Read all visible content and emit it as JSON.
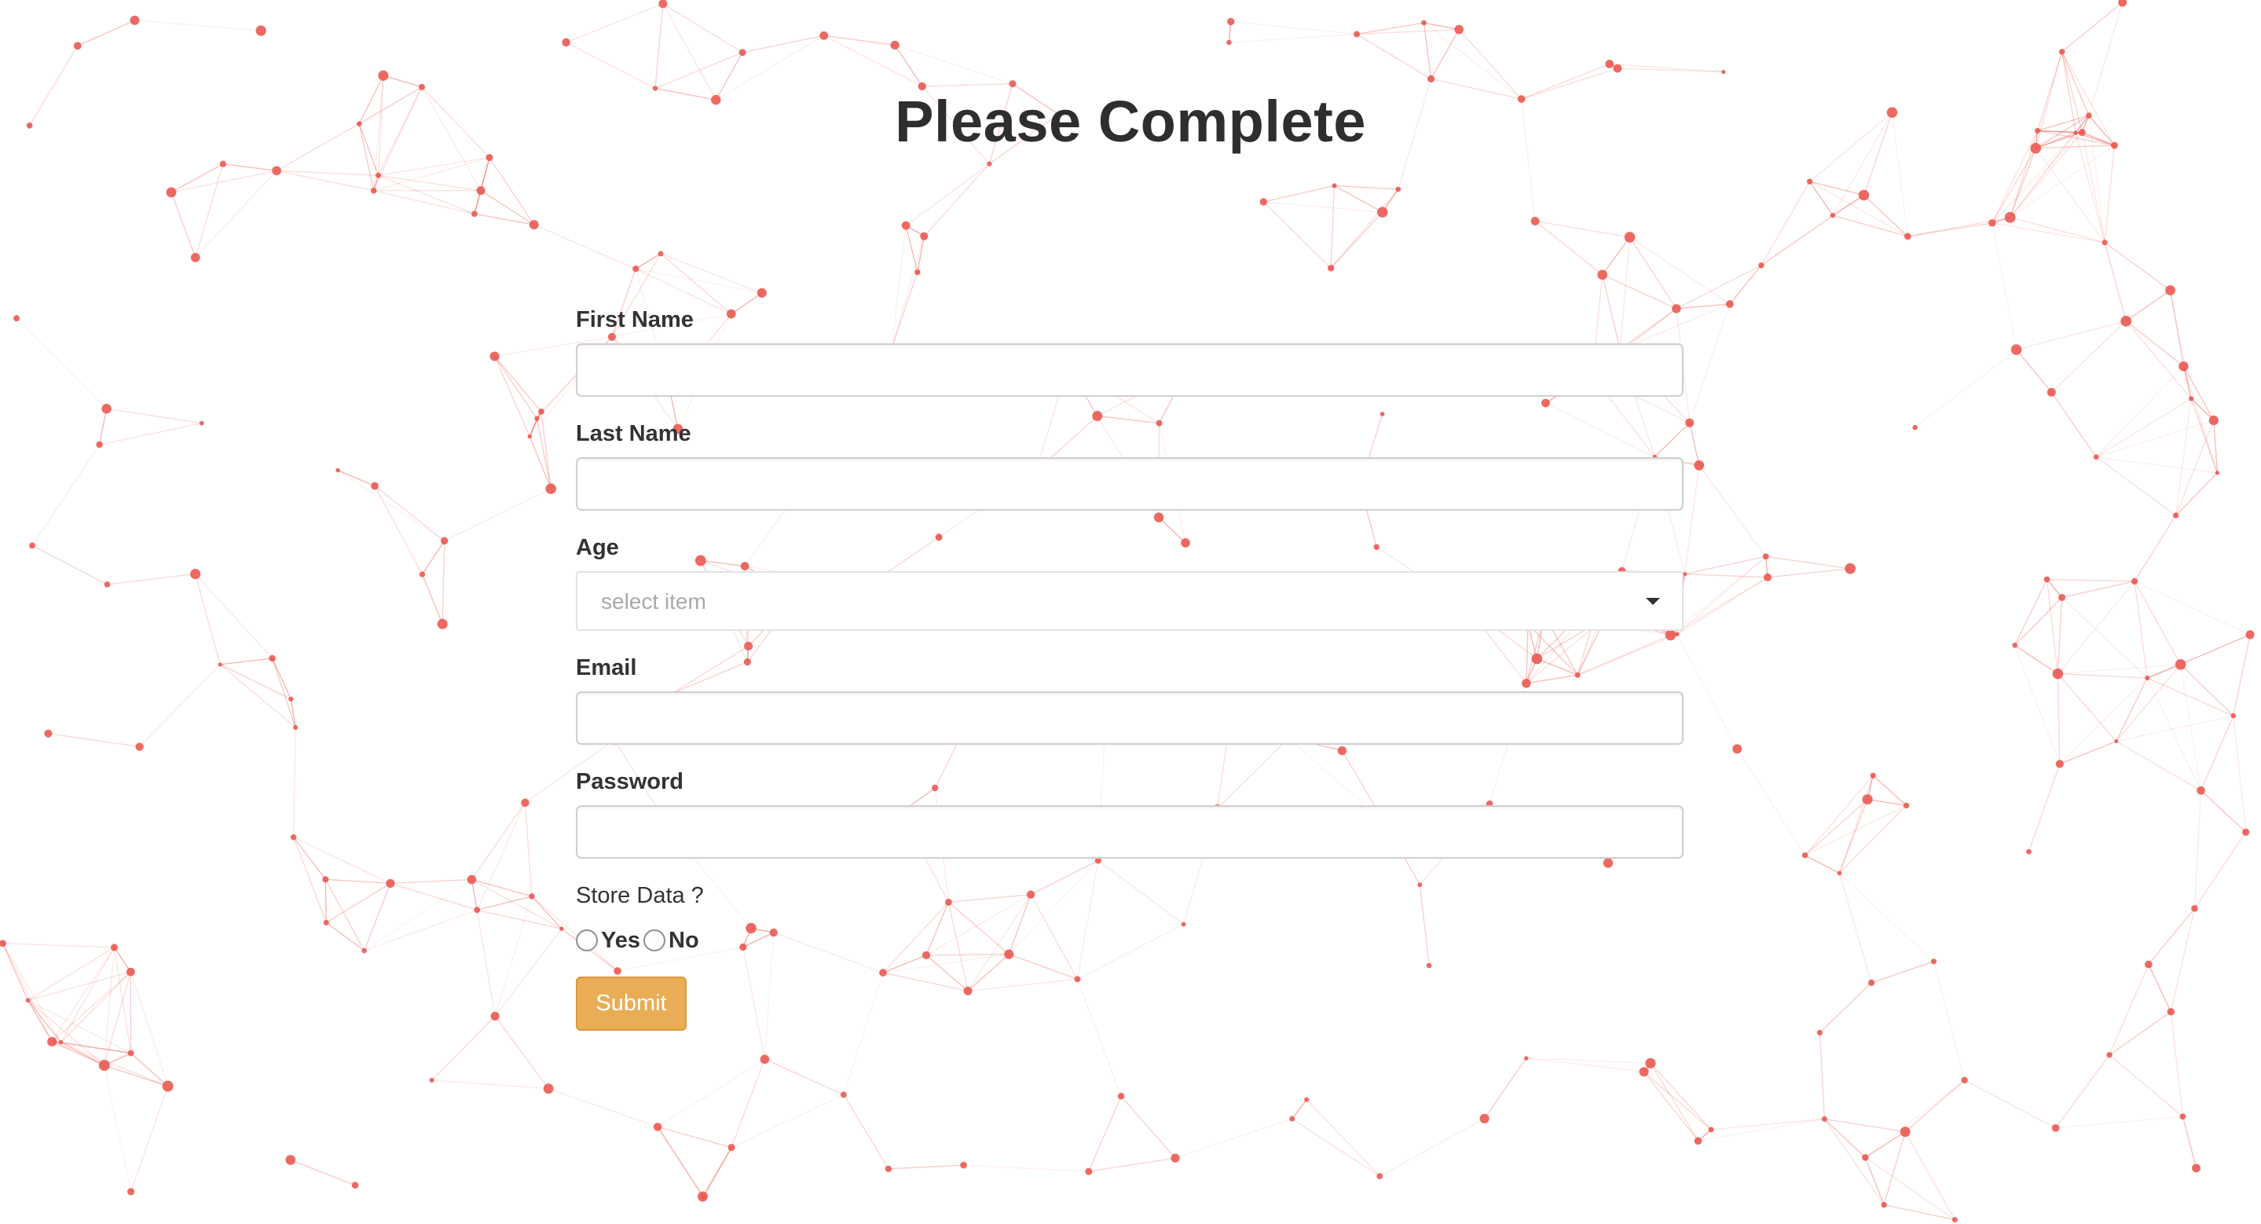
{
  "page": {
    "title": "Please Complete"
  },
  "form": {
    "first_name": {
      "label": "First Name",
      "value": ""
    },
    "last_name": {
      "label": "Last Name",
      "value": ""
    },
    "age": {
      "label": "Age",
      "placeholder": "select item"
    },
    "email": {
      "label": "Email",
      "value": ""
    },
    "password": {
      "label": "Password",
      "value": ""
    },
    "store_data": {
      "question": "Store Data ?",
      "options": [
        "Yes",
        "No"
      ],
      "selected": null
    },
    "submit_label": "Submit"
  },
  "colors": {
    "network": "#ea5a52",
    "submit": "#e8ad55",
    "title": "#2e2e2e"
  },
  "icons": {
    "age_dropdown": "caret-down-icon",
    "background": "particle-network"
  }
}
